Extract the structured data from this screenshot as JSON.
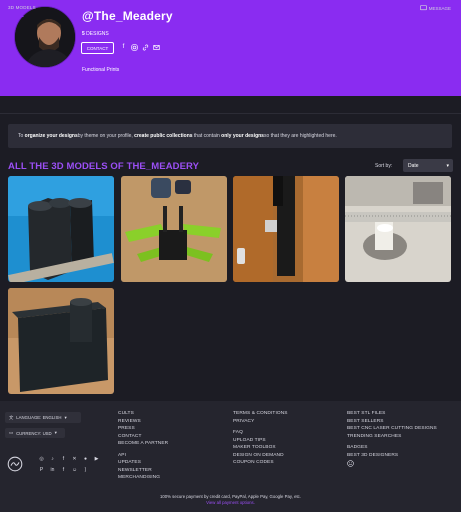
{
  "profile": {
    "username": "@The_Meadery",
    "designs_count": "5",
    "designs_label": "DESIGNS",
    "contact_label": "CONTACT",
    "bio": "Functional Prints",
    "socials": [
      "facebook-icon",
      "instagram-icon",
      "link-icon",
      "email-icon"
    ]
  },
  "tabs": {
    "models_label": "3D MODELS",
    "message_label": "MESSAGE"
  },
  "banner": {
    "t1": "To ",
    "b1": "organize your designs",
    "t2": " by theme on your profile, ",
    "b2": "create public collections",
    "t3": " that contain ",
    "b3": "only your designs",
    "t4": " so that they are highlighted here."
  },
  "models": {
    "title": "ALL THE 3D MODELS OF THE_MEADERY",
    "sort_label": "Sort by:",
    "sort_value": "Date"
  },
  "footer": {
    "language": "LANGUAGE: ENGLISH",
    "currency": "CURRENCY: USD",
    "col1": [
      "CULTS",
      "REVIEWS",
      "PRESS",
      "CONTACT",
      "BECOME A PARTNER",
      "",
      "API",
      "UPDATES",
      "NEWSLETTER",
      "MERCHANDISING"
    ],
    "col2": [
      "TERMS & CONDITIONS",
      "PRIVACY",
      "",
      "FAQ",
      "UPLOAD TIPS",
      "MAKER TOOLBOX",
      "DESIGN ON DEMAND",
      "COUPON CODES"
    ],
    "col3": [
      "BEST STL FILES",
      "BEST SELLERS",
      "BEST CNC LASER CUTTING DESIGNS",
      "TRENDING SEARCHES",
      "",
      "BADGES",
      "BEST 3D DESIGNERS"
    ],
    "payment_note": "100% secure payment by credit card, PayPal, Apple Pay, Google Pay, etc.",
    "payment_link": "View all payment options."
  },
  "colors": {
    "accent": "#8a2cf1",
    "title_purple": "#9b4ff5",
    "background": "#1c1c24"
  }
}
